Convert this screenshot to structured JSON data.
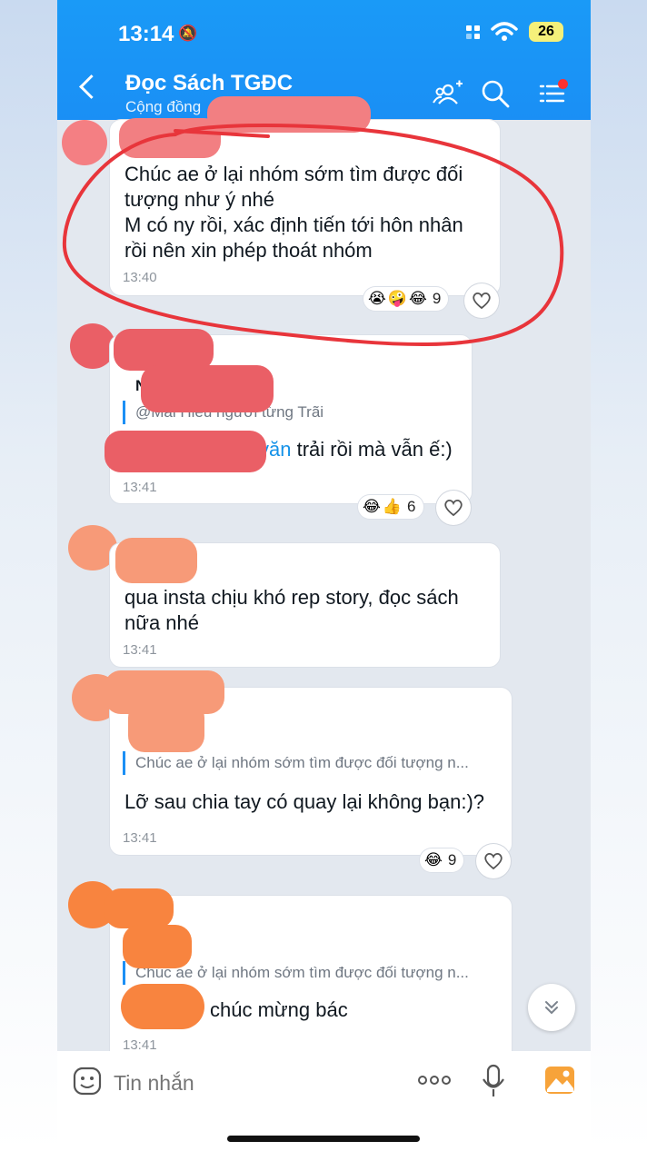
{
  "status": {
    "time": "13:14",
    "battery": "26"
  },
  "header": {
    "title": "Đọc Sách TGĐC",
    "subtitle": "Cộng đồng"
  },
  "messages": [
    {
      "text": "Chúc ae ở lại nhóm sớm tìm được đối\ntượng như ý nhé\nM có ny rồi, xác định tiến tới hôn nhân\nrồi nên xin phép thoát nhóm",
      "time": "13:40",
      "reactions": {
        "emojis": [
          "😭",
          "🤪",
          "😂"
        ],
        "count": "9"
      }
    },
    {
      "quote_name": "N",
      "quote": "@Mai Hiếu người từng Trãi",
      "link": "văn",
      "text": " trải rồi mà vẫn ế:)",
      "time": "13:41",
      "reactions": {
        "emojis": [
          "😂",
          "👍"
        ],
        "count": "6"
      }
    },
    {
      "text": "qua insta chịu khó rep story, đọc sách\nnữa nhé",
      "time": "13:41"
    },
    {
      "quote": "Chúc ae ở lại nhóm sớm tìm được đối tượng n...",
      "text": "Lỡ sau chia tay có quay lại không bạn:)?",
      "time": "13:41",
      "reactions": {
        "emojis": [
          "😂"
        ],
        "count": "9"
      }
    },
    {
      "quote": "Chúc ae ở lại nhóm sớm tìm được đối tượng n...",
      "text": "chúc mừng bác",
      "time": "13:41"
    }
  ],
  "composer": {
    "placeholder": "Tin nhắn"
  },
  "colors": {
    "header": "#1a9af7",
    "annotation": "#e8353b",
    "accent": "#1b8ff5"
  },
  "icons": [
    "bell-off-icon",
    "signal-icon",
    "wifi-icon",
    "back-icon",
    "group-add-icon",
    "search-icon",
    "menu-icon",
    "heart-icon",
    "chevrons-down-icon",
    "sticker-icon",
    "more-icon",
    "mic-icon",
    "image-icon"
  ]
}
